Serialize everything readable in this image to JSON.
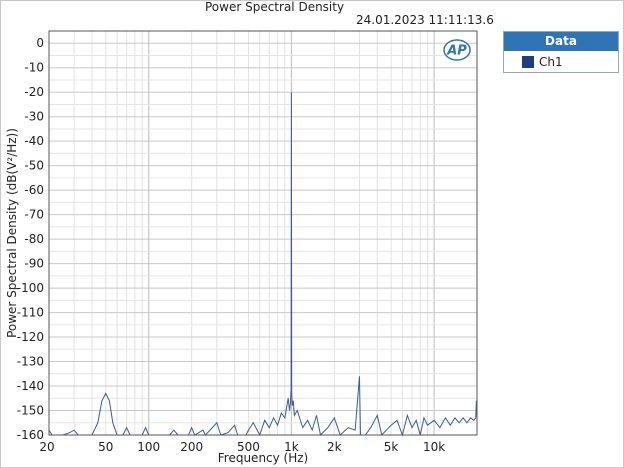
{
  "chart_data": {
    "type": "line",
    "title": "Power Spectral Density",
    "timestamp": "24.01.2023 11:11:13.6",
    "xlabel": "Frequency (Hz)",
    "ylabel": "Power Spectral Density (dB(V²/Hz))",
    "x_scale": "log",
    "xlim": [
      20,
      20000
    ],
    "ylim": [
      -160,
      5
    ],
    "grid": true,
    "x_ticks": [
      {
        "value": 20,
        "label": "20"
      },
      {
        "value": 50,
        "label": "50"
      },
      {
        "value": 100,
        "label": "100"
      },
      {
        "value": 200,
        "label": "200"
      },
      {
        "value": 500,
        "label": "500"
      },
      {
        "value": 1000,
        "label": "1k"
      },
      {
        "value": 2000,
        "label": "2k"
      },
      {
        "value": 5000,
        "label": "5k"
      },
      {
        "value": 10000,
        "label": "10k"
      }
    ],
    "y_ticks": [
      0,
      -10,
      -20,
      -30,
      -40,
      -50,
      -60,
      -70,
      -80,
      -90,
      -100,
      -110,
      -120,
      -130,
      -140,
      -150,
      -160
    ],
    "legend": {
      "title": "Data",
      "placement": "right"
    },
    "series": [
      {
        "name": "Ch1",
        "color": "#3a5a9a",
        "points": [
          [
            20,
            -158
          ],
          [
            21,
            -160
          ],
          [
            25,
            -160
          ],
          [
            28,
            -159
          ],
          [
            30,
            -158
          ],
          [
            32,
            -160
          ],
          [
            40,
            -160
          ],
          [
            44,
            -155
          ],
          [
            47,
            -146
          ],
          [
            50,
            -143
          ],
          [
            53,
            -146
          ],
          [
            56,
            -155
          ],
          [
            60,
            -160
          ],
          [
            66,
            -160
          ],
          [
            70,
            -157
          ],
          [
            74,
            -160
          ],
          [
            90,
            -160
          ],
          [
            95,
            -157
          ],
          [
            100,
            -160
          ],
          [
            140,
            -160
          ],
          [
            150,
            -158
          ],
          [
            160,
            -160
          ],
          [
            190,
            -160
          ],
          [
            200,
            -157
          ],
          [
            210,
            -160
          ],
          [
            240,
            -158
          ],
          [
            250,
            -160
          ],
          [
            300,
            -155
          ],
          [
            320,
            -160
          ],
          [
            360,
            -159
          ],
          [
            400,
            -156
          ],
          [
            420,
            -160
          ],
          [
            480,
            -160
          ],
          [
            500,
            -158
          ],
          [
            540,
            -155
          ],
          [
            600,
            -160
          ],
          [
            650,
            -154
          ],
          [
            700,
            -157
          ],
          [
            750,
            -153
          ],
          [
            800,
            -156
          ],
          [
            850,
            -151
          ],
          [
            900,
            -153
          ],
          [
            930,
            -148
          ],
          [
            950,
            -145
          ],
          [
            970,
            -150
          ],
          [
            985,
            -147
          ],
          [
            995,
            -141
          ],
          [
            1000,
            -20
          ],
          [
            1005,
            -143
          ],
          [
            1015,
            -148
          ],
          [
            1030,
            -146
          ],
          [
            1050,
            -152
          ],
          [
            1100,
            -150
          ],
          [
            1200,
            -157
          ],
          [
            1300,
            -154
          ],
          [
            1400,
            -158
          ],
          [
            1500,
            -152
          ],
          [
            1600,
            -160
          ],
          [
            1800,
            -157
          ],
          [
            2000,
            -153
          ],
          [
            2200,
            -160
          ],
          [
            2500,
            -157
          ],
          [
            2800,
            -158
          ],
          [
            3000,
            -136
          ],
          [
            3050,
            -160
          ],
          [
            3300,
            -160
          ],
          [
            3600,
            -157
          ],
          [
            4000,
            -152
          ],
          [
            4300,
            -160
          ],
          [
            5000,
            -156
          ],
          [
            5500,
            -154
          ],
          [
            6000,
            -160
          ],
          [
            6500,
            -152
          ],
          [
            7000,
            -157
          ],
          [
            7500,
            -154
          ],
          [
            8000,
            -160
          ],
          [
            8500,
            -153
          ],
          [
            9000,
            -156
          ],
          [
            10000,
            -154
          ],
          [
            11000,
            -157
          ],
          [
            12000,
            -153
          ],
          [
            13000,
            -156
          ],
          [
            14000,
            -153
          ],
          [
            15000,
            -155
          ],
          [
            16000,
            -153
          ],
          [
            17000,
            -155
          ],
          [
            18000,
            -153
          ],
          [
            19000,
            -154
          ],
          [
            19600,
            -153
          ],
          [
            19800,
            -146
          ],
          [
            20000,
            -153
          ]
        ]
      }
    ]
  }
}
